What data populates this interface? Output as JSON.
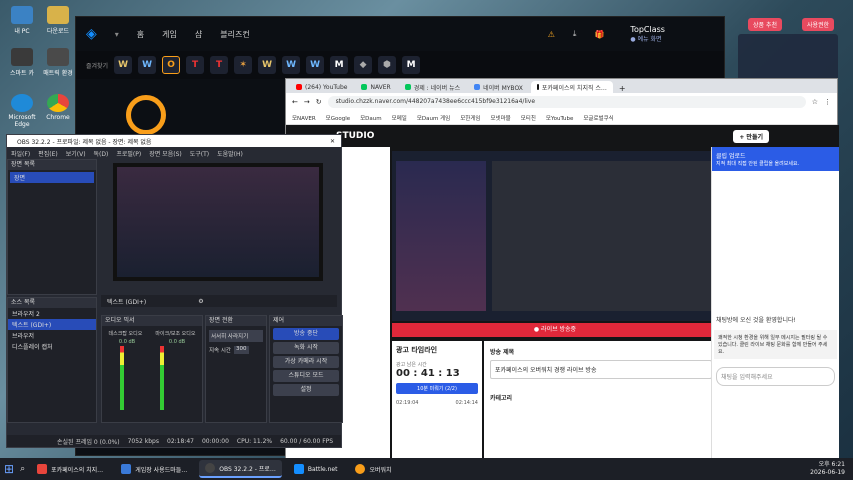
{
  "desktop": {
    "icons": [
      {
        "label": "내 PC",
        "color": "#3b82c4"
      },
      {
        "label": "다운로드",
        "color": "#d8b24a"
      },
      {
        "label": "스마트 카",
        "color": "#3a3a3a"
      },
      {
        "label": "매트릭 환경",
        "color": "#4a4a4a"
      },
      {
        "label": "Microsoft Edge",
        "color": "#1f8ad8"
      },
      {
        "label": "Chrome",
        "color": "#e8453c"
      }
    ],
    "top_right_buttons": [
      "상품 추천",
      "사용권한"
    ]
  },
  "battlenet": {
    "nav": [
      "홈",
      "게임",
      "샵",
      "블리즈컨"
    ],
    "profile_name": "TopClass",
    "profile_status": "● 예뉴 화면",
    "game_label": "즐겨찾기",
    "games": [
      "W",
      "W",
      "O",
      "T",
      "T",
      "✶",
      "W",
      "W",
      "W",
      "M",
      "◆",
      "⬢",
      "M"
    ]
  },
  "chrome": {
    "tabs": [
      {
        "label": "(264) YouTube",
        "color": "#ff0000"
      },
      {
        "label": "NAVER",
        "color": "#03c75a"
      },
      {
        "label": "경제 : 네이버 뉴스",
        "color": "#03c75a"
      },
      {
        "label": "네이버 MYBOX",
        "color": "#4285f4"
      },
      {
        "label": "포카페이스의 치지직 스…",
        "color": "#111",
        "active": true
      }
    ],
    "url": "studio.chzzk.naver.com/448207a7438ee6ccc415bf9e31216a4/live",
    "bookmarks": [
      "모NAVER",
      "모Google",
      "모Daum",
      "모메일",
      "모Daum 게임",
      "모한게임",
      "모넷마블",
      "모티친",
      "모YouTube",
      "모글로벌쿠식"
    ],
    "studio": {
      "title": "STUDIO",
      "live_button": "+ 만들기",
      "live_status": "● 라이브 방송중",
      "ad_timeline_label": "광고 타임라인",
      "ad_timer_label": "광고 남은 시간",
      "ad_timer": "00 : 41 : 13",
      "ad_button": "10분 미뤄기 (2/2)",
      "ad_times": [
        "02:19:04",
        "02:14:14"
      ],
      "stream_title_label": "방송 제목",
      "stream_title": "포카페이스의 오버워치 경쟁 라이브 방송",
      "category_label": "카테고리",
      "chat_header": "클립 업로드",
      "chat_subheader": "지적 최대 직접 안된 클립을 올려보세요.",
      "chat_welcome": "채팅방에 오신 것을 환영합니다!",
      "chat_notice": "쾌적한 시청 환경을 위해 일부 메시지는 필터링 될 수 있습니다. 클린 라이브 채팅 문화를 함께 만들어 주세요.",
      "chat_placeholder": "채팅을 입력해주세요"
    }
  },
  "obs": {
    "title": "OBS 32.2.2 - 프로파일: 제목 없음 - 장면: 제목 없음",
    "menu": [
      "파일(F)",
      "편집(E)",
      "보기(V)",
      "독(D)",
      "프로필(P)",
      "장면 모음(S)",
      "도구(T)",
      "도움말(H)"
    ],
    "scenes_header": "장면 목록",
    "scenes": [
      "장면"
    ],
    "sources_header": "소스 목록",
    "sources": [
      "브라우저 2",
      "텍스트 (GDI+)",
      "브라우저",
      "디스플레이 캡처"
    ],
    "selected_source": "텍스트 (GDI+)",
    "mixer_header": "오디오 믹서",
    "mixer_channels": [
      "데스크탑 오디오",
      "마이크/보조 오디오"
    ],
    "mixer_levels": [
      "0.0 dB",
      "0.0 dB"
    ],
    "transition_header": "장면 전환",
    "transition_value": "서서히 사라지기",
    "transition_duration_label": "지속 시간",
    "transition_duration": "300",
    "controls_header": "제어",
    "controls": [
      "방송 중단",
      "녹화 시작",
      "가상 카메라 시작",
      "스튜디오 모드",
      "설정"
    ],
    "status": {
      "dropped": "손실된 프레임 0 (0.0%)",
      "bitrate": "7052 kbps",
      "live_time": "02:18:47",
      "rec_time": "00:00:00",
      "cpu": "CPU: 11.2%",
      "fps": "60.00 / 60.00 FPS"
    }
  },
  "taskbar": {
    "items": [
      {
        "label": "포카페이스의 치지…",
        "color": "#e8453c"
      },
      {
        "label": "게임장 사용드마들…",
        "color": "#3a7ad8"
      },
      {
        "label": "OBS 32.2.2 - 프로…",
        "color": "#444",
        "active": true
      },
      {
        "label": "Battle.net",
        "color": "#148eff"
      },
      {
        "label": "오버워치",
        "color": "#f99e1a"
      }
    ],
    "time": "오후 6:21",
    "date": "2026-06-19"
  }
}
